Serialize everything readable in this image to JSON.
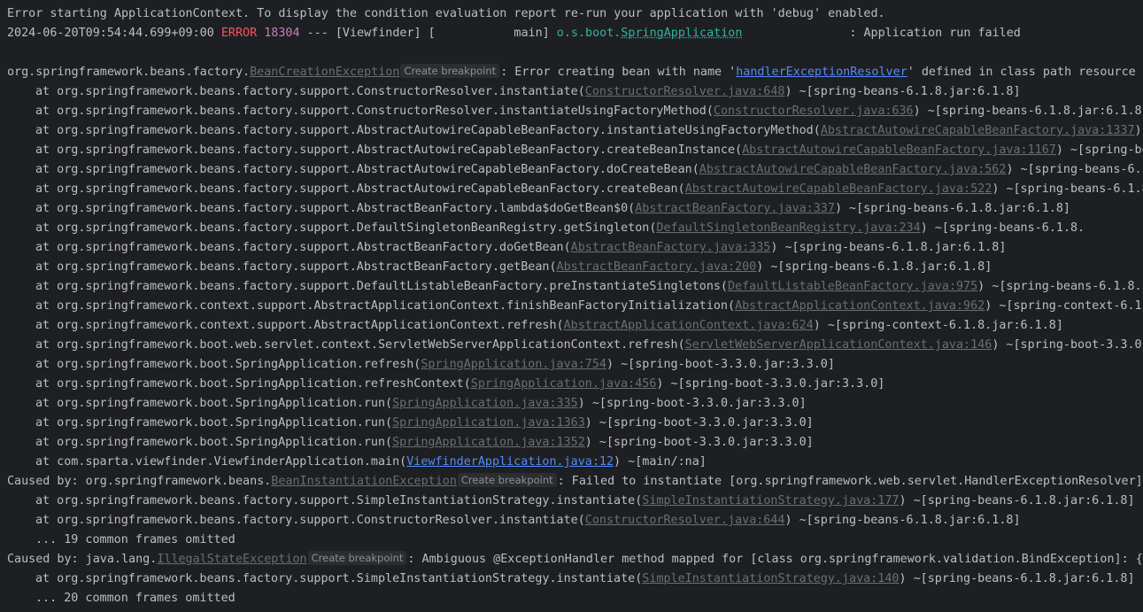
{
  "console": {
    "lines": [
      {
        "segments": [
          {
            "text": "Error starting ApplicationContext. To display the condition evaluation report re-run your application with 'debug' enabled.",
            "style": "plain"
          }
        ]
      },
      {
        "segments": [
          {
            "text": "2024-06-20T09:54:44.699+09:00 ",
            "style": "plain"
          },
          {
            "text": "ERROR",
            "style": "error"
          },
          {
            "text": " ",
            "style": "plain"
          },
          {
            "text": "18304",
            "style": "pid"
          },
          {
            "text": " --- [Viewfinder] [           main] ",
            "style": "plain"
          },
          {
            "text": "o.s.boot.",
            "style": "logger"
          },
          {
            "text": "SpringApplication",
            "style": "logger_link"
          },
          {
            "text": "               : Application run failed",
            "style": "plain"
          }
        ]
      },
      {
        "segments": [
          {
            "text": " ",
            "style": "plain"
          }
        ]
      },
      {
        "segments": [
          {
            "text": "org.springframework.beans.factory.",
            "style": "plain"
          },
          {
            "text": "BeanCreationException",
            "style": "link"
          },
          {
            "text": "Create breakpoint",
            "style": "chip"
          },
          {
            "text": ": Error creating bean with name '",
            "style": "plain"
          },
          {
            "text": "handlerExceptionResolver",
            "style": "link_bean"
          },
          {
            "text": "' defined in class path resource [o",
            "style": "plain"
          }
        ]
      },
      {
        "frame": true,
        "segments": [
          {
            "text": "at org.springframework.beans.factory.support.ConstructorResolver.instantiate(",
            "style": "plain"
          },
          {
            "text": "ConstructorResolver.java:648",
            "style": "link"
          },
          {
            "text": ") ~[spring-beans-6.1.8.jar:6.1.8]",
            "style": "plain"
          }
        ]
      },
      {
        "frame": true,
        "segments": [
          {
            "text": "at org.springframework.beans.factory.support.ConstructorResolver.instantiateUsingFactoryMethod(",
            "style": "plain"
          },
          {
            "text": "ConstructorResolver.java:636",
            "style": "link"
          },
          {
            "text": ") ~[spring-beans-6.1.8.jar:6.1.8]",
            "style": "plain"
          }
        ]
      },
      {
        "frame": true,
        "segments": [
          {
            "text": "at org.springframework.beans.factory.support.AbstractAutowireCapableBeanFactory.instantiateUsingFactoryMethod(",
            "style": "plain"
          },
          {
            "text": "AbstractAutowireCapableBeanFactory.java:1337",
            "style": "link"
          },
          {
            "text": ") ~",
            "style": "plain"
          }
        ]
      },
      {
        "frame": true,
        "segments": [
          {
            "text": "at org.springframework.beans.factory.support.AbstractAutowireCapableBeanFactory.createBeanInstance(",
            "style": "plain"
          },
          {
            "text": "AbstractAutowireCapableBeanFactory.java:1167",
            "style": "link"
          },
          {
            "text": ") ~[spring-bea",
            "style": "plain"
          }
        ]
      },
      {
        "frame": true,
        "segments": [
          {
            "text": "at org.springframework.beans.factory.support.AbstractAutowireCapableBeanFactory.doCreateBean(",
            "style": "plain"
          },
          {
            "text": "AbstractAutowireCapableBeanFactory.java:562",
            "style": "link"
          },
          {
            "text": ") ~[spring-beans-6.1",
            "style": "plain"
          }
        ]
      },
      {
        "frame": true,
        "segments": [
          {
            "text": "at org.springframework.beans.factory.support.AbstractAutowireCapableBeanFactory.createBean(",
            "style": "plain"
          },
          {
            "text": "AbstractAutowireCapableBeanFactory.java:522",
            "style": "link"
          },
          {
            "text": ") ~[spring-beans-6.1.8",
            "style": "plain"
          }
        ]
      },
      {
        "frame": true,
        "segments": [
          {
            "text": "at org.springframework.beans.factory.support.AbstractBeanFactory.lambda$doGetBean$0(",
            "style": "plain"
          },
          {
            "text": "AbstractBeanFactory.java:337",
            "style": "link"
          },
          {
            "text": ") ~[spring-beans-6.1.8.jar:6.1.8]",
            "style": "plain"
          }
        ]
      },
      {
        "frame": true,
        "segments": [
          {
            "text": "at org.springframework.beans.factory.support.DefaultSingletonBeanRegistry.getSingleton(",
            "style": "plain"
          },
          {
            "text": "DefaultSingletonBeanRegistry.java:234",
            "style": "link"
          },
          {
            "text": ") ~[spring-beans-6.1.8.",
            "style": "plain"
          }
        ]
      },
      {
        "frame": true,
        "segments": [
          {
            "text": "at org.springframework.beans.factory.support.AbstractBeanFactory.doGetBean(",
            "style": "plain"
          },
          {
            "text": "AbstractBeanFactory.java:335",
            "style": "link"
          },
          {
            "text": ") ~[spring-beans-6.1.8.jar:6.1.8]",
            "style": "plain"
          }
        ]
      },
      {
        "frame": true,
        "segments": [
          {
            "text": "at org.springframework.beans.factory.support.AbstractBeanFactory.getBean(",
            "style": "plain"
          },
          {
            "text": "AbstractBeanFactory.java:200",
            "style": "link"
          },
          {
            "text": ") ~[spring-beans-6.1.8.jar:6.1.8]",
            "style": "plain"
          }
        ]
      },
      {
        "frame": true,
        "segments": [
          {
            "text": "at org.springframework.beans.factory.support.DefaultListableBeanFactory.preInstantiateSingletons(",
            "style": "plain"
          },
          {
            "text": "DefaultListableBeanFactory.java:975",
            "style": "link"
          },
          {
            "text": ") ~[spring-beans-6.1.8.ja",
            "style": "plain"
          }
        ]
      },
      {
        "frame": true,
        "segments": [
          {
            "text": "at org.springframework.context.support.AbstractApplicationContext.finishBeanFactoryInitialization(",
            "style": "plain"
          },
          {
            "text": "AbstractApplicationContext.java:962",
            "style": "link"
          },
          {
            "text": ") ~[spring-context-6.1.",
            "style": "plain"
          }
        ]
      },
      {
        "frame": true,
        "segments": [
          {
            "text": "at org.springframework.context.support.AbstractApplicationContext.refresh(",
            "style": "plain"
          },
          {
            "text": "AbstractApplicationContext.java:624",
            "style": "link"
          },
          {
            "text": ") ~[spring-context-6.1.8.jar:6.1.8]",
            "style": "plain"
          }
        ]
      },
      {
        "frame": true,
        "segments": [
          {
            "text": "at org.springframework.boot.web.servlet.context.ServletWebServerApplicationContext.refresh(",
            "style": "plain"
          },
          {
            "text": "ServletWebServerApplicationContext.java:146",
            "style": "link"
          },
          {
            "text": ") ~[spring-boot-3.3.0.",
            "style": "plain"
          }
        ]
      },
      {
        "frame": true,
        "segments": [
          {
            "text": "at org.springframework.boot.SpringApplication.refresh(",
            "style": "plain"
          },
          {
            "text": "SpringApplication.java:754",
            "style": "link"
          },
          {
            "text": ") ~[spring-boot-3.3.0.jar:3.3.0]",
            "style": "plain"
          }
        ]
      },
      {
        "frame": true,
        "segments": [
          {
            "text": "at org.springframework.boot.SpringApplication.refreshContext(",
            "style": "plain"
          },
          {
            "text": "SpringApplication.java:456",
            "style": "link"
          },
          {
            "text": ") ~[spring-boot-3.3.0.jar:3.3.0]",
            "style": "plain"
          }
        ]
      },
      {
        "frame": true,
        "segments": [
          {
            "text": "at org.springframework.boot.SpringApplication.run(",
            "style": "plain"
          },
          {
            "text": "SpringApplication.java:335",
            "style": "link"
          },
          {
            "text": ") ~[spring-boot-3.3.0.jar:3.3.0]",
            "style": "plain"
          }
        ]
      },
      {
        "frame": true,
        "segments": [
          {
            "text": "at org.springframework.boot.SpringApplication.run(",
            "style": "plain"
          },
          {
            "text": "SpringApplication.java:1363",
            "style": "link"
          },
          {
            "text": ") ~[spring-boot-3.3.0.jar:3.3.0]",
            "style": "plain"
          }
        ]
      },
      {
        "frame": true,
        "segments": [
          {
            "text": "at org.springframework.boot.SpringApplication.run(",
            "style": "plain"
          },
          {
            "text": "SpringApplication.java:1352",
            "style": "link"
          },
          {
            "text": ") ~[spring-boot-3.3.0.jar:3.3.0]",
            "style": "plain"
          }
        ]
      },
      {
        "frame": true,
        "segments": [
          {
            "text": "at com.sparta.viewfinder.ViewfinderApplication.main(",
            "style": "plain"
          },
          {
            "text": "ViewfinderApplication.java:12",
            "style": "link_blue"
          },
          {
            "text": ") ~[main/:na]",
            "style": "plain"
          }
        ]
      },
      {
        "segments": [
          {
            "text": "Caused by: org.springframework.beans.",
            "style": "plain"
          },
          {
            "text": "BeanInstantiationException",
            "style": "link"
          },
          {
            "text": "Create breakpoint",
            "style": "chip"
          },
          {
            "text": ": Failed to instantiate [org.springframework.web.servlet.HandlerExceptionResolver]: ",
            "style": "plain"
          }
        ]
      },
      {
        "frame": true,
        "segments": [
          {
            "text": "at org.springframework.beans.factory.support.SimpleInstantiationStrategy.instantiate(",
            "style": "plain"
          },
          {
            "text": "SimpleInstantiationStrategy.java:177",
            "style": "link"
          },
          {
            "text": ") ~[spring-beans-6.1.8.jar:6.1.8]",
            "style": "plain"
          }
        ]
      },
      {
        "frame": true,
        "segments": [
          {
            "text": "at org.springframework.beans.factory.support.ConstructorResolver.instantiate(",
            "style": "plain"
          },
          {
            "text": "ConstructorResolver.java:644",
            "style": "link"
          },
          {
            "text": ") ~[spring-beans-6.1.8.jar:6.1.8]",
            "style": "plain"
          }
        ]
      },
      {
        "frame": true,
        "segments": [
          {
            "text": "... 19 common frames omitted",
            "style": "plain"
          }
        ]
      },
      {
        "chevron": true,
        "segments": [
          {
            "text": "Caused by: java.lang.",
            "style": "plain"
          },
          {
            "text": "IllegalStateException",
            "style": "link"
          },
          {
            "text": "Create breakpoint",
            "style": "chip"
          },
          {
            "text": ": Ambiguous @ExceptionHandler method mapped for [class org.springframework.validation.BindException]: {pu",
            "style": "plain"
          }
        ]
      },
      {
        "frame": true,
        "segments": [
          {
            "text": "at org.springframework.beans.factory.support.SimpleInstantiationStrategy.instantiate(",
            "style": "plain"
          },
          {
            "text": "SimpleInstantiationStrategy.java:140",
            "style": "link"
          },
          {
            "text": ") ~[spring-beans-6.1.8.jar:6.1.8]",
            "style": "plain"
          }
        ]
      },
      {
        "frame": true,
        "segments": [
          {
            "text": "... 20 common frames omitted",
            "style": "plain"
          }
        ]
      }
    ],
    "chevron_glyph": "›"
  }
}
